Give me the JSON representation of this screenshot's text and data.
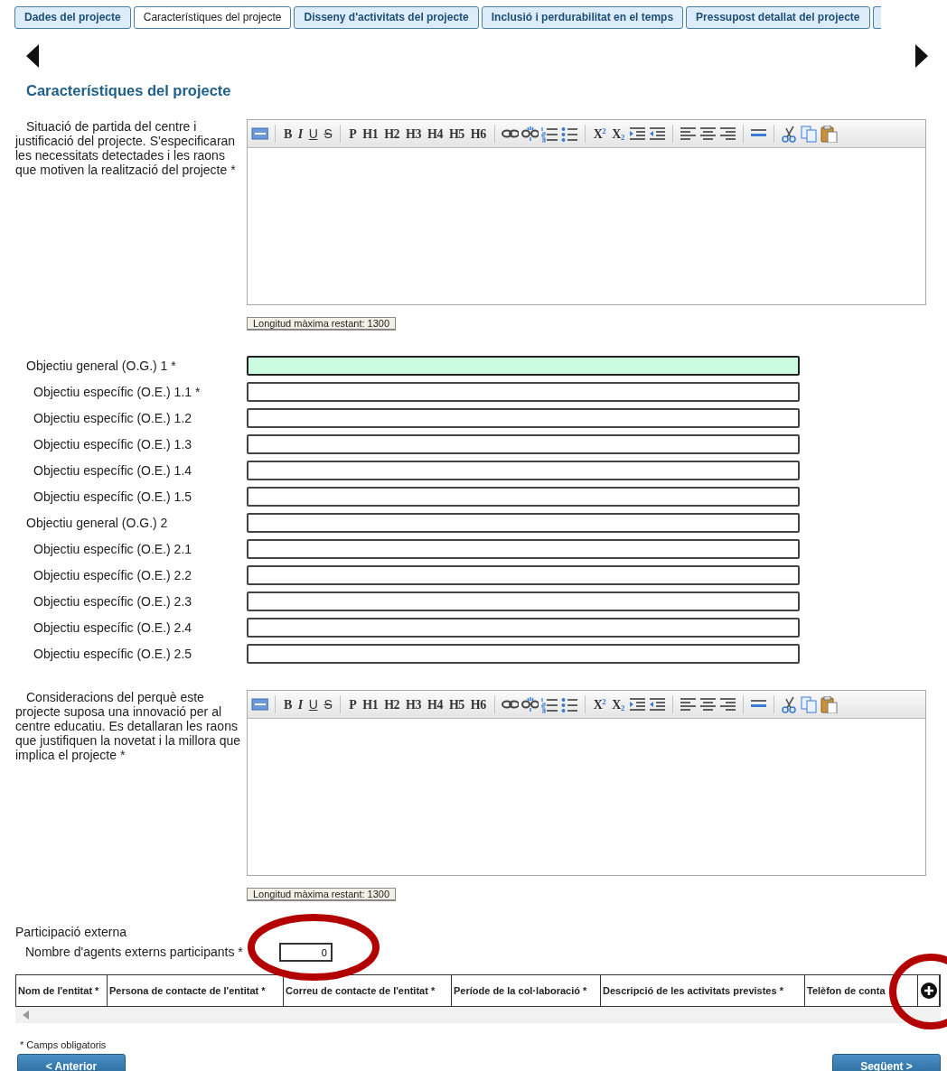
{
  "tabs": [
    {
      "label": "Dades del projecte",
      "selected": false
    },
    {
      "label": "Característiques del projecte",
      "selected": true
    },
    {
      "label": "Disseny d'activitats del projecte",
      "selected": false
    },
    {
      "label": "Inclusió i perdurabilitat en el temps",
      "selected": false
    },
    {
      "label": "Pressupost detallat del projecte",
      "selected": false
    }
  ],
  "heading": "Característiques del projecte",
  "situation": {
    "label": "Situació de partida del centre i justificació del projecte. S'especificaran les necessitats detectades i les raons que motiven la realització del projecte *",
    "toolbar": [
      "B",
      "I",
      "U",
      "S",
      "P",
      "H1",
      "H2",
      "H3",
      "H4",
      "H5",
      "H6",
      "X$^{2}$",
      "X$_{2}$"
    ],
    "counter": "Longitud màxima restant: 1300"
  },
  "objectives": [
    {
      "kind": "general",
      "label": "Objectiu general (O.G.) 1 *",
      "focused": true
    },
    {
      "kind": "specific",
      "label": "Objectiu específic (O.E.) 1.1 *",
      "focused": false
    },
    {
      "kind": "specific",
      "label": "Objectiu específic (O.E.) 1.2",
      "focused": false
    },
    {
      "kind": "specific",
      "label": "Objectiu específic (O.E.) 1.3",
      "focused": false
    },
    {
      "kind": "specific",
      "label": "Objectiu específic (O.E.) 1.4",
      "focused": false
    },
    {
      "kind": "specific",
      "label": "Objectiu específic (O.E.) 1.5",
      "focused": false
    },
    {
      "kind": "general",
      "label": "Objectiu general (O.G.) 2",
      "focused": false
    },
    {
      "kind": "specific",
      "label": "Objectiu específic (O.E.) 2.1",
      "focused": false
    },
    {
      "kind": "specific",
      "label": "Objectiu específic (O.E.) 2.2",
      "focused": false
    },
    {
      "kind": "specific",
      "label": "Objectiu específic (O.E.) 2.3",
      "focused": false
    },
    {
      "kind": "specific",
      "label": "Objectiu específic (O.E.) 2.4",
      "focused": false
    },
    {
      "kind": "specific",
      "label": "Objectiu específic (O.E.) 2.5",
      "focused": false
    }
  ],
  "innovation": {
    "label": "Consideracions del perquè este projecte suposa una innovació per al centre educatiu. Es detallaran les raons que justifiquen la novetat i la millora que implica el projecte *",
    "toolbar": [
      "B",
      "I",
      "U",
      "S",
      "P",
      "H1",
      "H2",
      "H3",
      "H4",
      "H5",
      "H6",
      "X$^{2}$",
      "X$_{2}$"
    ],
    "counter": "Longitud màxima restant: 1300"
  },
  "external": {
    "title": "Participació externa",
    "count_label": "Nombre d'agents externs participants *",
    "count_value": "0"
  },
  "table": {
    "columns": [
      "Nom de l'entitat *",
      "Persona de contacte de l'entitat *",
      "Correu de contacte de l'entitat *",
      "Període de la col·laboració *",
      "Descripció de les activitats previstes *",
      "Telèfon de conta"
    ]
  },
  "required_note": "* Camps obligatoris",
  "buttons": [
    {
      "kind": "prev",
      "label": "< Anterior"
    },
    {
      "kind": "next",
      "label": "Següent >"
    }
  ],
  "annotations": [
    {
      "kind": "ellipse",
      "color": "#b30000"
    },
    {
      "kind": "ellipse",
      "color": "#b30000"
    }
  ]
}
